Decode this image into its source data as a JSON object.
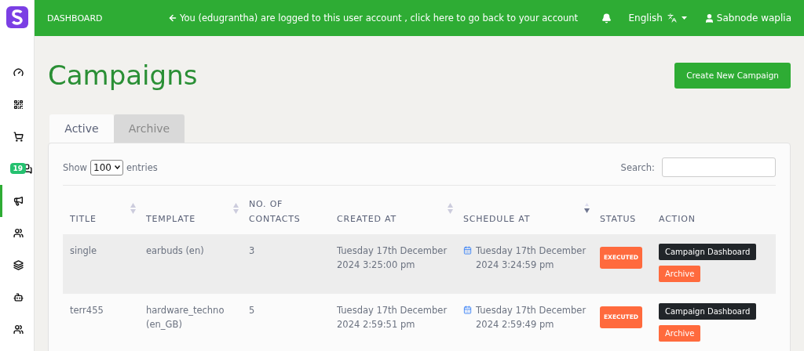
{
  "topbar": {
    "brand": "DASHBOARD",
    "notice": "You (edugrantha) are logged to this user account , click here to go back to your account",
    "language": "English",
    "user": "Sabnode waplia"
  },
  "sidebar": {
    "items": [
      {
        "kind": "dashboard",
        "selected": false
      },
      {
        "kind": "qr",
        "selected": false
      },
      {
        "kind": "cart",
        "selected": false
      },
      {
        "kind": "chat",
        "selected": false,
        "badge": "19"
      },
      {
        "kind": "campaign",
        "selected": true
      },
      {
        "kind": "contacts",
        "selected": false
      },
      {
        "kind": "layers",
        "selected": false
      },
      {
        "kind": "bot",
        "selected": false
      },
      {
        "kind": "team",
        "selected": false
      }
    ]
  },
  "page": {
    "title": "Campaigns",
    "create_button": "Create New Campaign"
  },
  "tabs": [
    {
      "label": "Active",
      "selected": true
    },
    {
      "label": "Archive",
      "selected": false
    }
  ],
  "table_controls": {
    "show_label": "Show",
    "page_size": "100",
    "entries_label": "entries",
    "search_label": "Search:"
  },
  "table": {
    "columns": [
      {
        "label": "TITLE",
        "sortable": true,
        "sorted_desc": false
      },
      {
        "label": "TEMPLATE",
        "sortable": true,
        "sorted_desc": false
      },
      {
        "label": "NO. OF CONTACTS",
        "sortable": false,
        "sorted_desc": false
      },
      {
        "label": "CREATED AT",
        "sortable": true,
        "sorted_desc": false
      },
      {
        "label": "SCHEDULE AT",
        "sortable": true,
        "sorted_desc": true
      },
      {
        "label": "STATUS",
        "sortable": false,
        "sorted_desc": false
      },
      {
        "label": "ACTION",
        "sortable": false,
        "sorted_desc": false
      }
    ],
    "rows": [
      {
        "title": "single",
        "template": "earbuds (en)",
        "contacts": "3",
        "created_at": "Tuesday 17th December 2024 3:25:00 pm",
        "schedule_at": "Tuesday 17th December 2024 3:24:59 pm",
        "status": "EXECUTED",
        "actions": [
          "Campaign Dashboard",
          "Archive"
        ]
      },
      {
        "title": "terr455",
        "template": "hardware_techno (en_GB)",
        "contacts": "5",
        "created_at": "Tuesday 17th December 2024 2:59:51 pm",
        "schedule_at": "Tuesday 17th December 2024 2:59:49 pm",
        "status": "EXECUTED",
        "actions": [
          "Campaign Dashboard",
          "Archive"
        ]
      }
    ]
  }
}
